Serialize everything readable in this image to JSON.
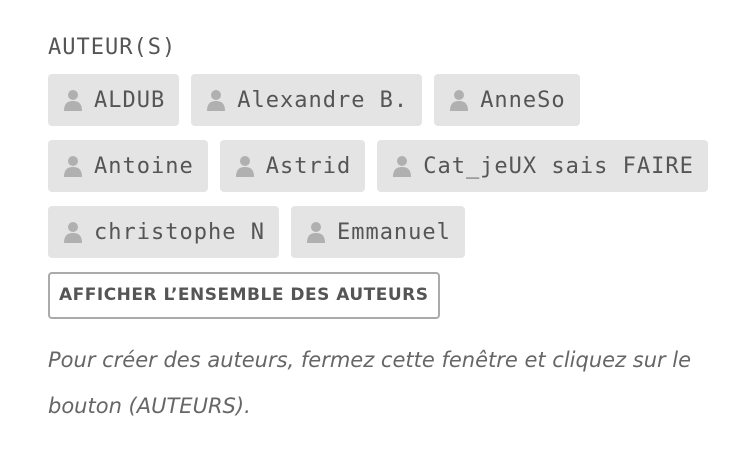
{
  "section": {
    "label": "AUTEUR(S)"
  },
  "authors": [
    {
      "name": "ALDUB",
      "icon": "user-icon"
    },
    {
      "name": "Alexandre B.",
      "icon": "user-icon"
    },
    {
      "name": "AnneSo",
      "icon": "user-icon"
    },
    {
      "name": "Antoine",
      "icon": "user-icon"
    },
    {
      "name": "Astrid",
      "icon": "user-icon"
    },
    {
      "name": "Cat_jeUX sais FAIRE",
      "icon": "user-icon"
    },
    {
      "name": "christophe N",
      "icon": "user-icon"
    },
    {
      "name": "Emmanuel",
      "icon": "user-icon"
    }
  ],
  "actions": {
    "show_all_label": "AFFICHER L’ENSEMBLE DES AUTEURS"
  },
  "help": {
    "text": "Pour créer des auteurs, fermez cette fenêtre et cliquez sur le bouton (AUTEURS)."
  },
  "colors": {
    "chip_background": "#e4e4e4",
    "text": "#555555",
    "icon": "#b0b0b0",
    "button_border": "#aaaaaa"
  }
}
